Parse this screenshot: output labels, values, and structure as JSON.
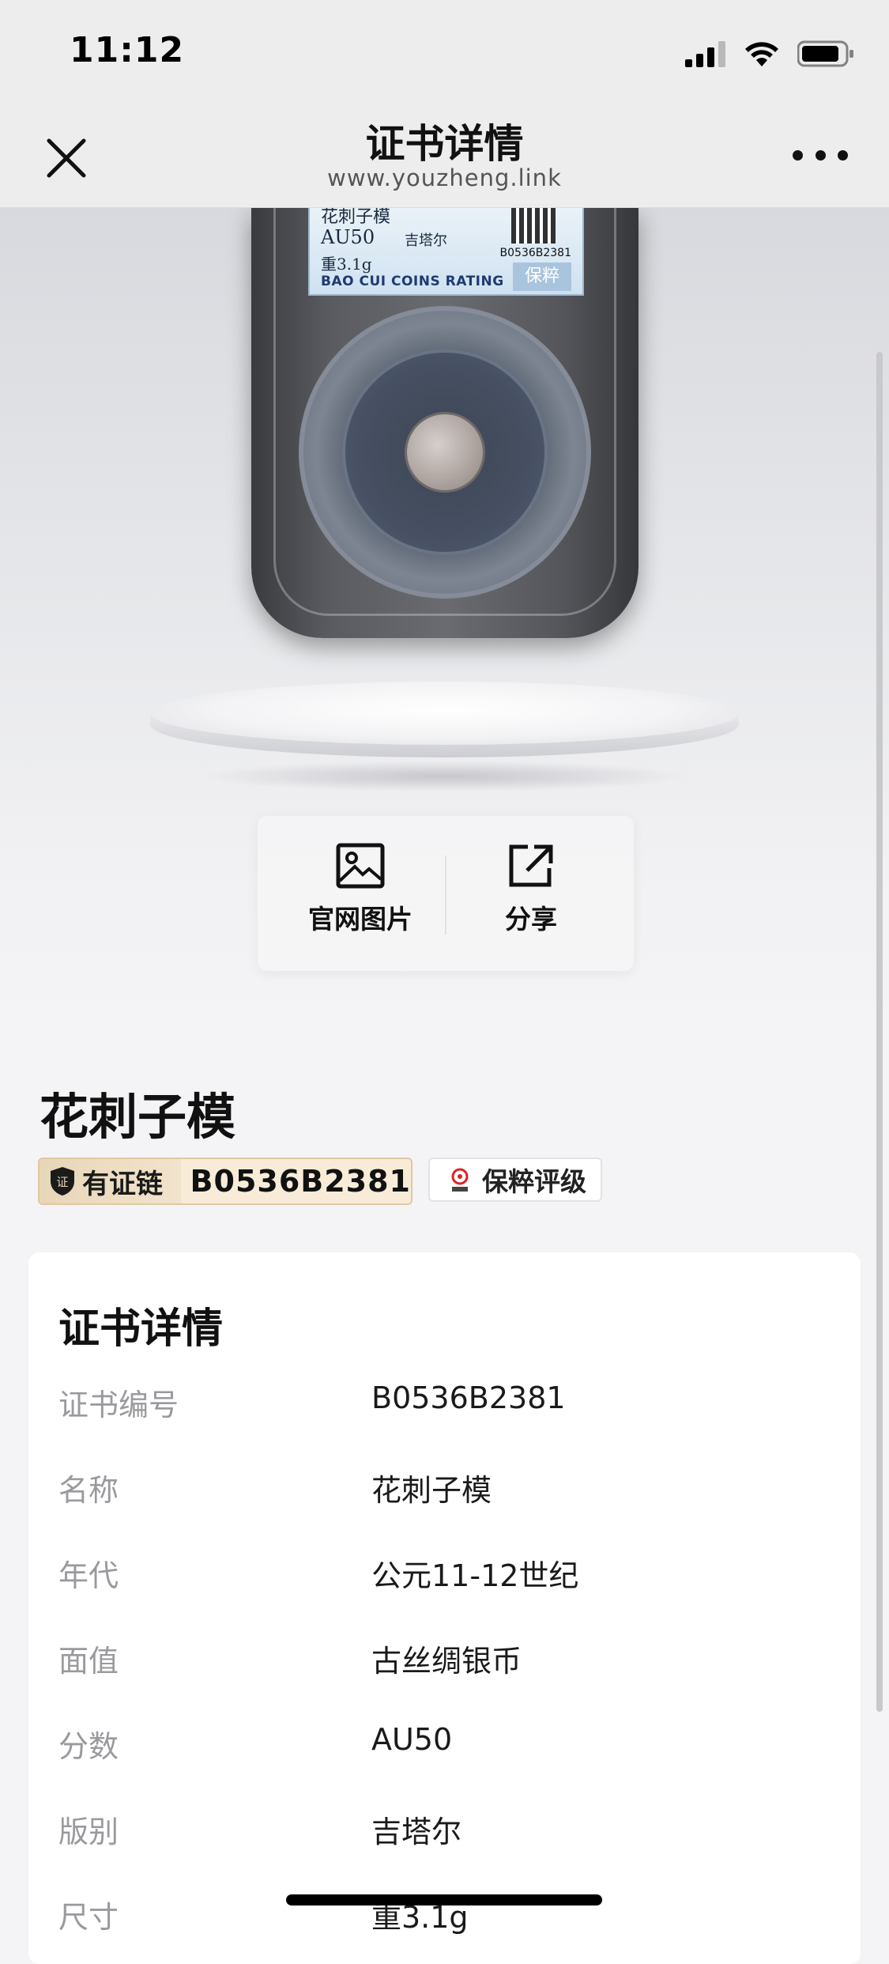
{
  "status_bar": {
    "time": "11:12"
  },
  "nav": {
    "title": "证书详情",
    "subtitle": "www.youzheng.link"
  },
  "slab_label": {
    "name": "花刺子模",
    "grade": "AU50",
    "place": "吉塔尔",
    "weight": "重3.1g",
    "rating": "BAO CUI COINS RATING",
    "serial": "B0536B2381",
    "stamp": "保粹"
  },
  "actions": [
    {
      "label": "官网图片",
      "icon": "image-icon"
    },
    {
      "label": "分享",
      "icon": "share-icon"
    }
  ],
  "item": {
    "title": "花刺子模",
    "chain_label": "有证链",
    "chain_serial": "B0536B2381",
    "brand_label": "保粹评级"
  },
  "details": {
    "title": "证书详情",
    "rows": [
      {
        "key": "证书编号",
        "value": "B0536B2381"
      },
      {
        "key": "名称",
        "value": "花刺子模"
      },
      {
        "key": "年代",
        "value": "公元11-12世纪"
      },
      {
        "key": "面值",
        "value": "古丝绸银币"
      },
      {
        "key": "分数",
        "value": "AU50"
      },
      {
        "key": "版别",
        "value": "吉塔尔"
      },
      {
        "key": "尺寸",
        "value": "重3.1g"
      }
    ]
  },
  "colors": {
    "nav_bg": "#ededed",
    "page_bg": "#f4f4f6",
    "chain_badge_bg": "#f8ecd8",
    "label_muted": "#9a9a9e"
  }
}
